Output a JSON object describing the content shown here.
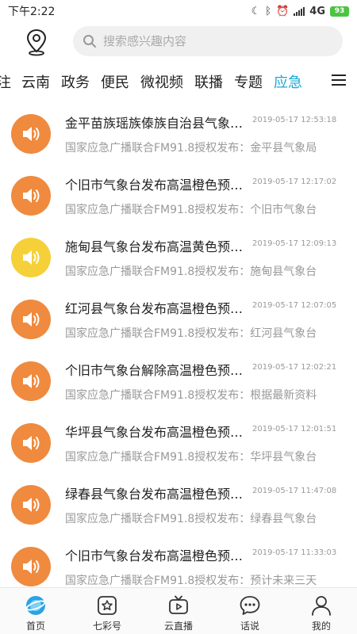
{
  "status_bar": {
    "time": "下午2:22",
    "network": "4G",
    "battery": "93"
  },
  "search": {
    "placeholder": "搜索感兴趣内容"
  },
  "tabs": [
    {
      "label": "注",
      "active": false
    },
    {
      "label": "云南",
      "active": false
    },
    {
      "label": "政务",
      "active": false
    },
    {
      "label": "便民",
      "active": false
    },
    {
      "label": "微视频",
      "active": false
    },
    {
      "label": "联播",
      "active": false
    },
    {
      "label": "专题",
      "active": false
    },
    {
      "label": "应急",
      "active": true
    }
  ],
  "items": [
    {
      "title": "金平苗族瑶族傣族自治县气象局发布",
      "time": "2019-05-17 12:53:18",
      "desc": "国家应急广播联合FM91.8授权发布：金平县气象局",
      "icon_color": "#ef8a3e"
    },
    {
      "title": "个旧市气象台发布高温橙色预警信号",
      "time": "2019-05-17 12:17:02",
      "desc": "国家应急广播联合FM91.8授权发布：个旧市气象台",
      "icon_color": "#ef8a3e"
    },
    {
      "title": "施甸县气象台发布高温黄色预警信号",
      "time": "2019-05-17 12:09:13",
      "desc": "国家应急广播联合FM91.8授权发布：施甸县气象台",
      "icon_color": "#f5d039"
    },
    {
      "title": "红河县气象台发布高温橙色预警信号",
      "time": "2019-05-17 12:07:05",
      "desc": "国家应急广播联合FM91.8授权发布：红河县气象台",
      "icon_color": "#ef8a3e"
    },
    {
      "title": "个旧市气象台解除高温橙色预警信号",
      "time": "2019-05-17 12:02:21",
      "desc": "国家应急广播联合FM91.8授权发布：根据最新资料",
      "icon_color": "#ef8a3e"
    },
    {
      "title": "华坪县气象台发布高温橙色预警信号",
      "time": "2019-05-17 12:01:51",
      "desc": "国家应急广播联合FM91.8授权发布：华坪县气象台",
      "icon_color": "#ef8a3e"
    },
    {
      "title": "绿春县气象台发布高温橙色预警信号",
      "time": "2019-05-17 11:47:08",
      "desc": "国家应急广播联合FM91.8授权发布：绿春县气象台",
      "icon_color": "#ef8a3e"
    },
    {
      "title": "个旧市气象台发布高温橙色预警信号",
      "time": "2019-05-17 11:33:03",
      "desc": "国家应急广播联合FM91.8授权发布：预计未来三天",
      "icon_color": "#ef8a3e"
    }
  ],
  "bottom_nav": [
    {
      "label": "首页",
      "icon": "home-planet-icon",
      "active": true
    },
    {
      "label": "七彩号",
      "icon": "star-box-icon",
      "active": false
    },
    {
      "label": "云直播",
      "icon": "tv-play-icon",
      "active": false
    },
    {
      "label": "话说",
      "icon": "chat-bubble-icon",
      "active": false
    },
    {
      "label": "我的",
      "icon": "user-icon",
      "active": false
    }
  ],
  "colors": {
    "accent": "#1aa8d8",
    "warning_orange": "#ef8a3e",
    "warning_yellow": "#f5d039"
  }
}
